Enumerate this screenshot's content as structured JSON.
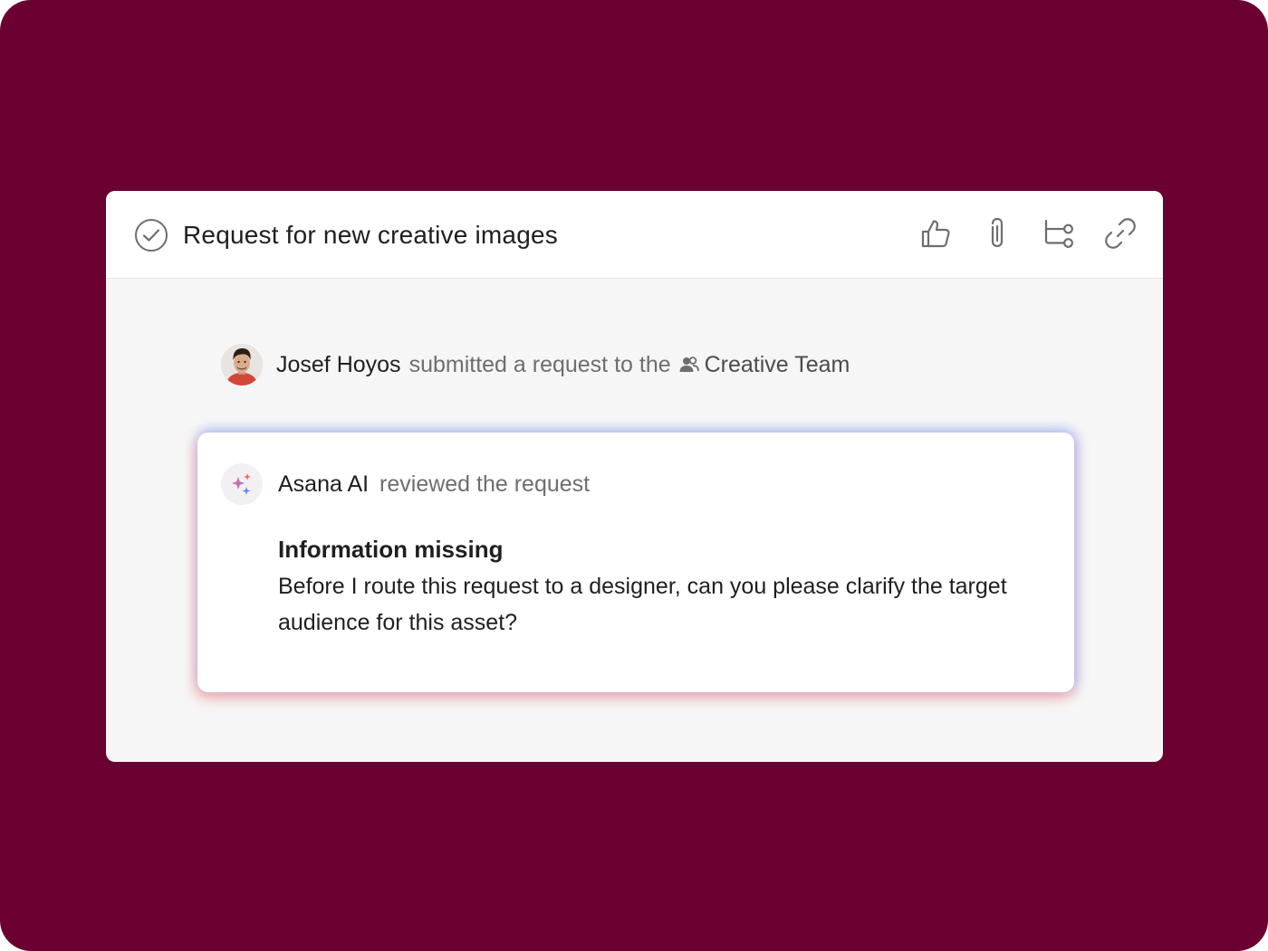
{
  "colors": {
    "backdrop": "#690031",
    "panel": "#f6f6f6",
    "header": "#ffffff",
    "text_primary": "#1e1f21",
    "text_secondary": "#6d6e6f"
  },
  "task": {
    "title": "Request for new creative images",
    "complete_icon": "check-circle-icon",
    "actions": [
      {
        "name": "like-button",
        "icon": "thumbs-up-icon"
      },
      {
        "name": "attach-button",
        "icon": "paperclip-icon"
      },
      {
        "name": "subtask-button",
        "icon": "subtasks-icon"
      },
      {
        "name": "copy-link-button",
        "icon": "link-icon"
      }
    ]
  },
  "activity": {
    "actor": "Josef Hoyos",
    "verb": "submitted a request to the",
    "team_icon": "team-icon",
    "team": "Creative Team"
  },
  "ai_review": {
    "icon": "sparkle-icon",
    "name": "Asana AI",
    "verb": "reviewed the request",
    "message_title": "Information missing",
    "message_body": "Before I route this request to a designer, can you please clarify the target audience for this asset?"
  }
}
